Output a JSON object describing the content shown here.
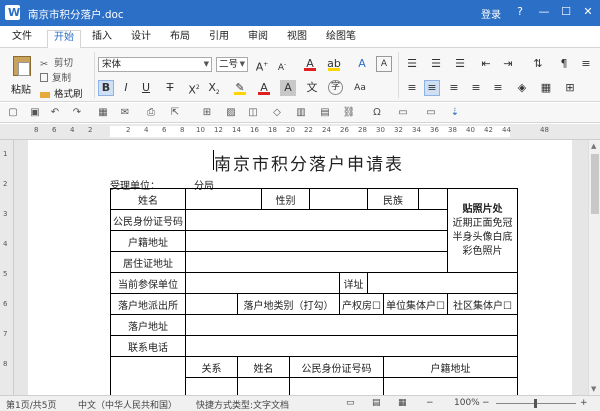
{
  "window": {
    "title": "南京市积分落户.doc",
    "login_label": "登录",
    "help_label": "?",
    "min_label": "—",
    "max_label": "☐",
    "close_label": "✕"
  },
  "tabs": [
    {
      "label": "文件"
    },
    {
      "label": "开始"
    },
    {
      "label": "插入"
    },
    {
      "label": "设计"
    },
    {
      "label": "布局"
    },
    {
      "label": "引用"
    },
    {
      "label": "审阅"
    },
    {
      "label": "视图"
    },
    {
      "label": "绘图笔"
    }
  ],
  "ribbon": {
    "paste_label": "粘贴",
    "cut_label": "剪切",
    "copy_label": "复制",
    "format_painter_label": "格式刷",
    "font_name": "宋体",
    "font_size": "二号",
    "accent_color": "#2b6fc6",
    "font_color": "#e02020",
    "highlight_color": "#ffd400"
  },
  "document": {
    "title": "南京市积分落户申请表",
    "accept_unit_label": "受理单位：",
    "branch_label": "分局",
    "form": {
      "name": "姓名",
      "gender": "性别",
      "ethnicity": "民族",
      "photo_title": "贴照片处",
      "photo_desc": "近期正面免冠半身头像白底彩色照片",
      "id_number": "公民身份证号码",
      "household_address": "户籍地址",
      "residence_address": "居住证地址",
      "insurance_unit": "当前参保单位",
      "detail": "详址",
      "police_station": "落户地派出所",
      "settle_type": "落户地类别（打勾）",
      "opt_property": "产权房☐",
      "opt_unit": "单位集体户☐",
      "opt_community": "社区集体户☐",
      "settle_address": "落户地址",
      "phone": "联系电话",
      "relation": "关系",
      "member_name": "姓名",
      "member_id": "公民身份证号码",
      "member_household": "户籍地址"
    }
  },
  "status": {
    "page": "第1页/共5页",
    "language": "中文（中华人民共和国）",
    "doc_type": "快捷方式类型:文字文档",
    "zoom": "100%"
  }
}
